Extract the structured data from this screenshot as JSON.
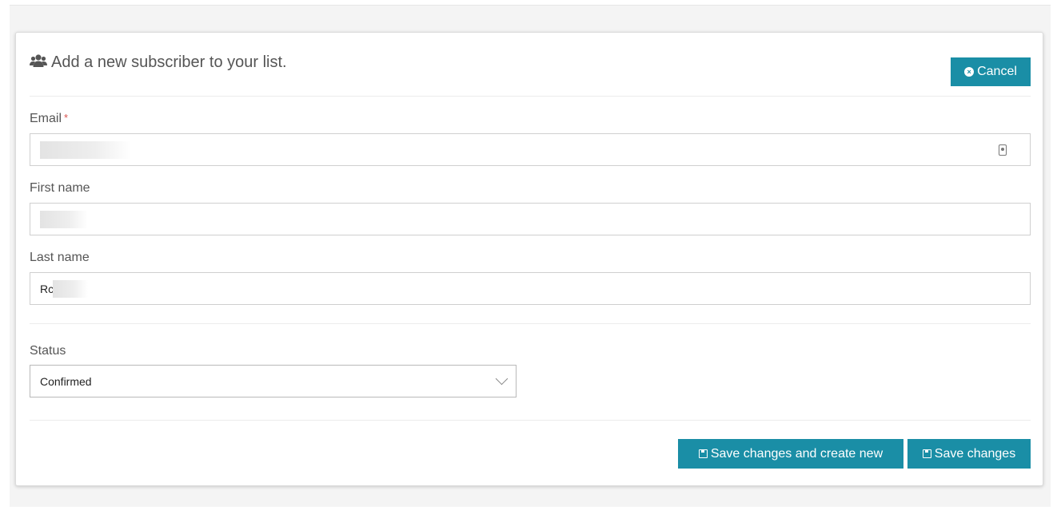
{
  "form": {
    "title": "Add a new subscriber to your list.",
    "cancel_label": "Cancel"
  },
  "fields": {
    "email": {
      "label": "Email",
      "required_mark": "*",
      "value": ""
    },
    "first_name": {
      "label": "First name",
      "value": ""
    },
    "last_name": {
      "label": "Last name",
      "value": "Rc"
    }
  },
  "status": {
    "label": "Status",
    "selected": "Confirmed"
  },
  "actions": {
    "save_and_new_label": "Save changes and create new",
    "save_label": "Save changes"
  },
  "colors": {
    "accent": "#1a8ea6",
    "required": "#d9534f"
  }
}
